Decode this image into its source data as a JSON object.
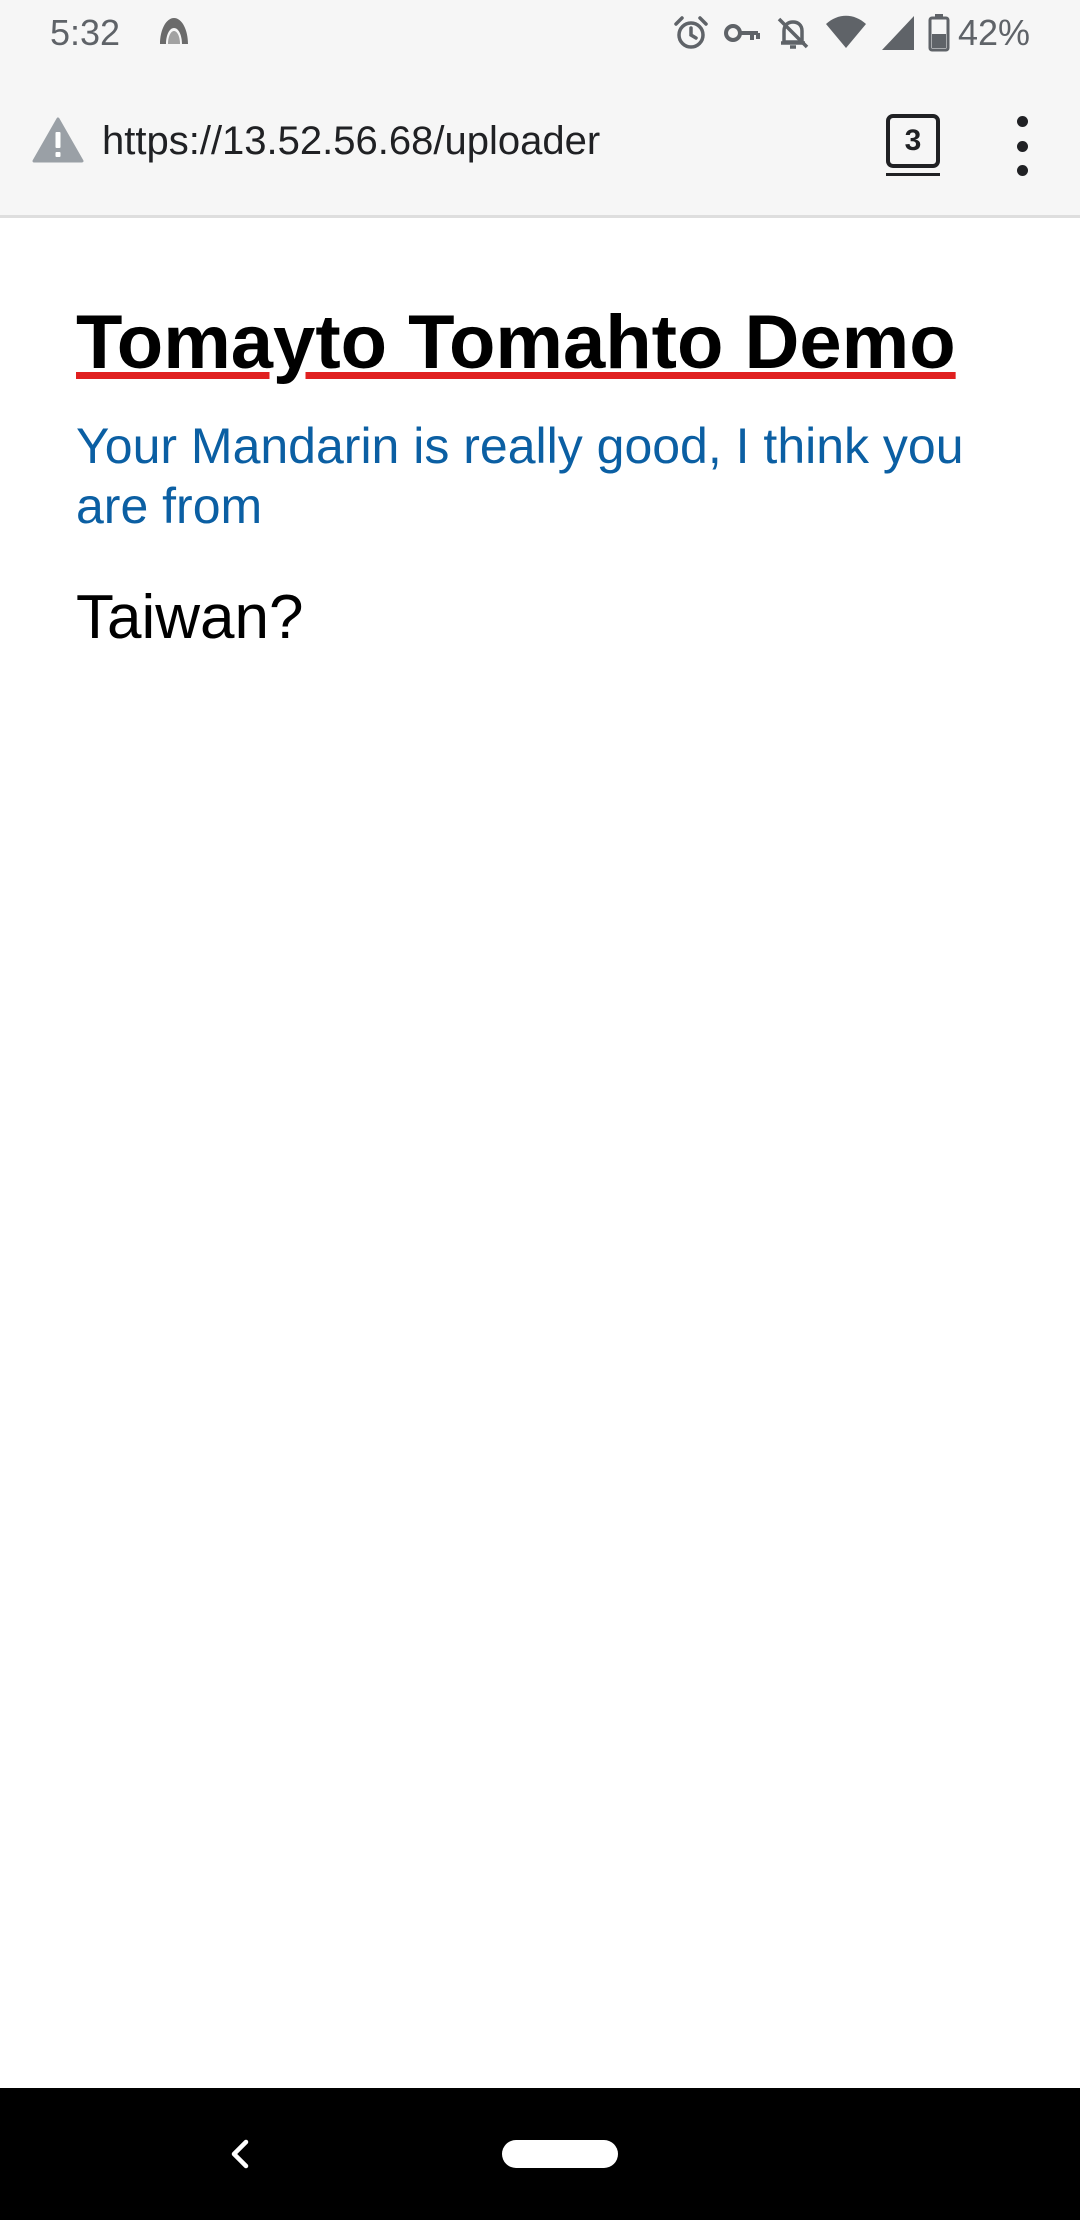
{
  "status_bar": {
    "time": "5:32",
    "battery_percent": "42%",
    "icons": [
      "notification-icon",
      "alarm-icon",
      "vpn-key-icon",
      "silent-icon",
      "wifi-icon",
      "signal-icon",
      "battery-icon"
    ]
  },
  "toolbar": {
    "url": "https://13.52.56.68/uploader",
    "security_icon": "warning-icon",
    "tab_count": "3"
  },
  "page": {
    "title": "Tomayto Tomahto Demo",
    "subtitle": "Your Mandarin is really good, I think you are from",
    "result": "Taiwan?"
  },
  "colors": {
    "title_underline": "#e02020",
    "subtitle": "#0b5fa3",
    "bars": "#f6f6f6"
  }
}
